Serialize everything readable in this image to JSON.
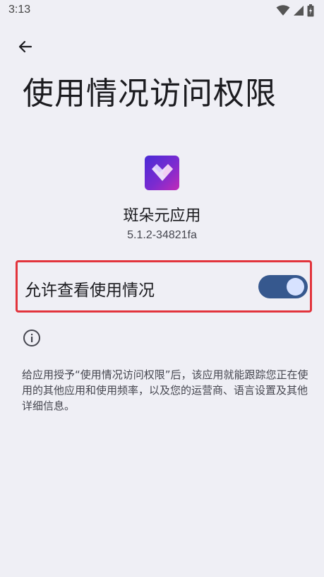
{
  "status_bar": {
    "time": "3:13",
    "icons": [
      "wifi-icon",
      "signal-icon",
      "battery-icon"
    ]
  },
  "header": {
    "back_icon": "arrow-left-icon",
    "title": "使用情况访问权限"
  },
  "app": {
    "icon": "app-logo-icon",
    "name": "斑朵元应用",
    "version": "5.1.2-34821fa"
  },
  "permission_toggle": {
    "label": "允许查看使用情况",
    "enabled": true
  },
  "info": {
    "icon": "info-icon",
    "text": "给应用授予“使用情况访问权限”后，该应用就能跟踪您正在使用的其他应用和使用频率，以及您的运营商、语言设置及其他详细信息。"
  },
  "colors": {
    "background": "#efeff5",
    "switch_track_on": "#36588e",
    "switch_thumb_on": "#d7e2ff",
    "highlight_border": "#e2343c"
  }
}
